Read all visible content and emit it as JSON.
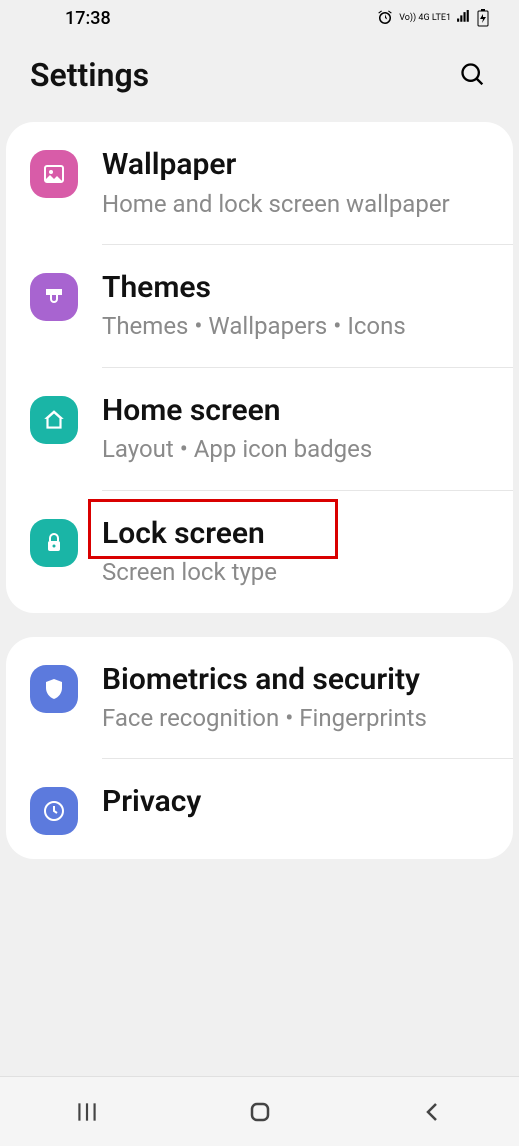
{
  "status": {
    "time": "17:38",
    "network": "Vo)) 4G LTE1"
  },
  "header": {
    "title": "Settings"
  },
  "groups": [
    {
      "items": [
        {
          "id": "wallpaper",
          "title": "Wallpaper",
          "subtitle": "Home and lock screen wallpaper",
          "iconColor": "icon-pink",
          "icon": "picture"
        },
        {
          "id": "themes",
          "title": "Themes",
          "subtitle": "Themes  •  Wallpapers  •  Icons",
          "iconColor": "icon-purple",
          "icon": "brush"
        },
        {
          "id": "home-screen",
          "title": "Home screen",
          "subtitle": "Layout  •  App icon badges",
          "iconColor": "icon-teal",
          "icon": "home"
        },
        {
          "id": "lock-screen",
          "title": "Lock screen",
          "subtitle": "Screen lock type",
          "iconColor": "icon-teal",
          "icon": "lock",
          "highlighted": true
        }
      ]
    },
    {
      "items": [
        {
          "id": "biometrics",
          "title": "Biometrics and security",
          "subtitle": "Face recognition  •  Fingerprints",
          "iconColor": "icon-blue",
          "icon": "shield"
        },
        {
          "id": "privacy",
          "title": "Privacy",
          "subtitle": "",
          "iconColor": "icon-blue",
          "icon": "privacy"
        }
      ]
    }
  ]
}
